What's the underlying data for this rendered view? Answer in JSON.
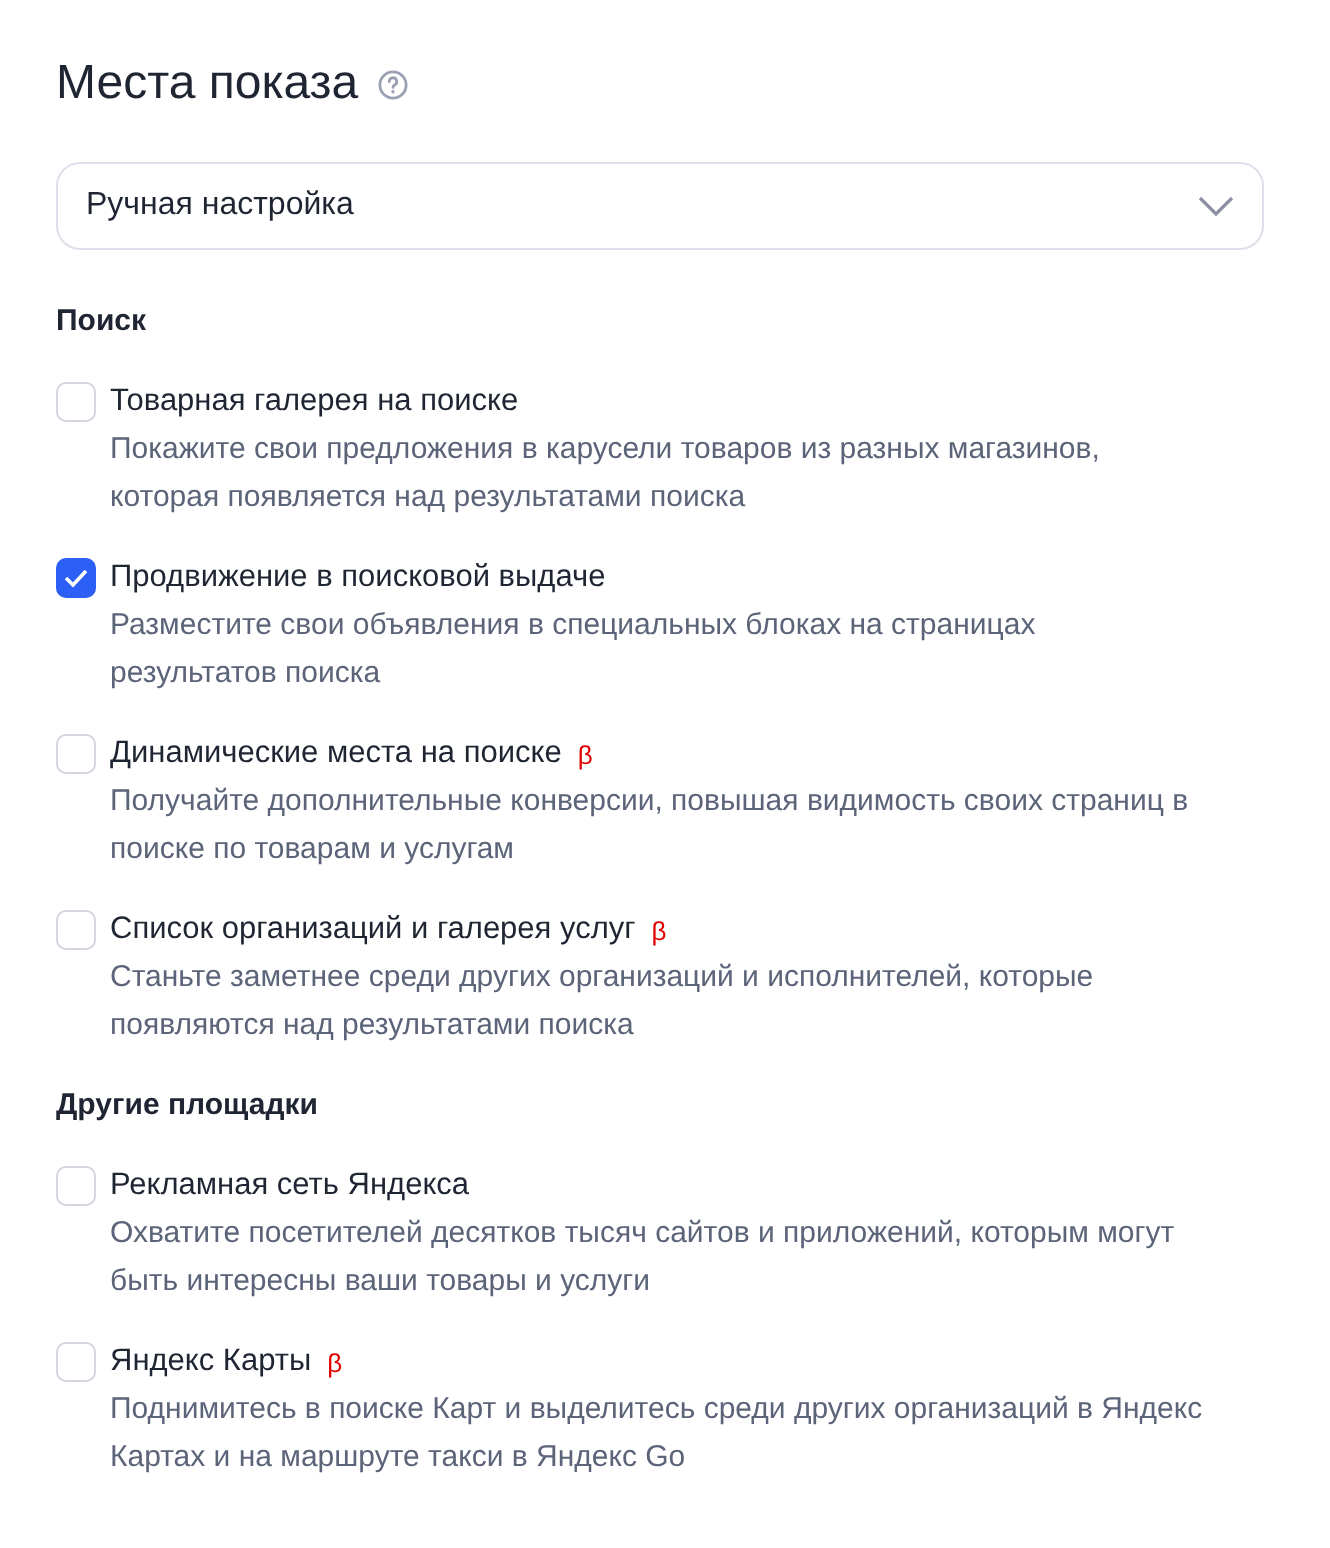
{
  "title": "Места показа",
  "select": {
    "value": "Ручная настройка"
  },
  "sections": [
    {
      "heading": "Поиск",
      "items": [
        {
          "label": "Товарная галерея на поиске",
          "checked": false,
          "description": "Покажите свои предложения в карусели товаров из разных магазинов, которая появляется над результатами поиска"
        },
        {
          "label": "Продвижение в поисковой выдаче",
          "checked": true,
          "description": "Разместите свои объявления в специальных блоках на страницах результатов поиска"
        },
        {
          "label": "Динамические места на поиске",
          "badge": "β",
          "checked": false,
          "description": "Получайте дополнительные конверсии, повышая видимость своих страниц в поиске по товарам и услугам"
        },
        {
          "label": "Список организаций и галерея услуг",
          "badge": "β",
          "checked": false,
          "description": "Станьте заметнее среди других организаций и исполнителей, которые появляются над результатами поиска"
        }
      ]
    },
    {
      "heading": "Другие площадки",
      "items": [
        {
          "label": "Рекламная сеть Яндекса",
          "checked": false,
          "description": "Охватите посетителей десятков тысяч сайтов и приложений, которым могут быть интересны ваши товары и услуги"
        },
        {
          "label": "Яндекс Карты",
          "badge": "β",
          "checked": false,
          "description": "Поднимитесь в поиске Карт и выделитесь среди других организаций в Яндекс Картах и на маршруте такси в Яндекс Go"
        }
      ]
    }
  ]
}
